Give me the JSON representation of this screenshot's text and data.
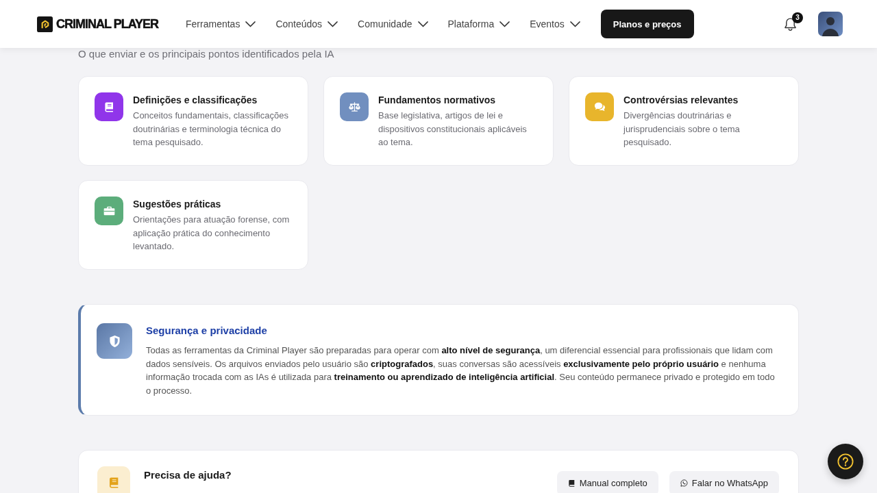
{
  "header": {
    "brand": "CRIMINAL PLAYER",
    "nav": [
      {
        "label": "Ferramentas"
      },
      {
        "label": "Conteúdos"
      },
      {
        "label": "Comunidade"
      },
      {
        "label": "Plataforma"
      },
      {
        "label": "Eventos"
      }
    ],
    "cta": "Planos e preços",
    "notification_count": "3"
  },
  "features": {
    "subtitle": "O que enviar e os principais pontos identificados pela IA",
    "cards": [
      {
        "title": "Definições e classificações",
        "description": "Conceitos fundamentais, classificações doutrinárias e terminologia técnica do tema pesquisado.",
        "color": "#9035ea"
      },
      {
        "title": "Fundamentos normativos",
        "description": "Base legislativa, artigos de lei e dispositivos constitucionais aplicáveis ao tema.",
        "color": "#718fbf"
      },
      {
        "title": "Controvérsias relevantes",
        "description": "Divergências doutrinárias e jurisprudenciais sobre o tema pesquisado.",
        "color": "#e8b52c"
      },
      {
        "title": "Sugestões práticas",
        "description": "Orientações para atuação forense, com aplicação prática do conhecimento levantado.",
        "color": "#5cad7b"
      }
    ]
  },
  "security": {
    "title": "Segurança e privacidade",
    "text": "Todas as ferramentas da Criminal Player são preparadas para operar com **alto nível de segurança**, um diferencial essencial para profissionais que lidam com dados sensíveis. Os arquivos enviados pelo usuário são **criptografados**, suas conversas são acessíveis **exclusivamente pelo próprio usuário** e nenhuma informação trocada com as IAs é utilizada para **treinamento ou aprendizado de inteligência artificial**. Seu conteúdo permanece privado e protegido em todo o processo."
  },
  "help": {
    "title": "Precisa de ajuda?",
    "buttons": [
      "Manual completo",
      "Falar no WhatsApp"
    ]
  }
}
